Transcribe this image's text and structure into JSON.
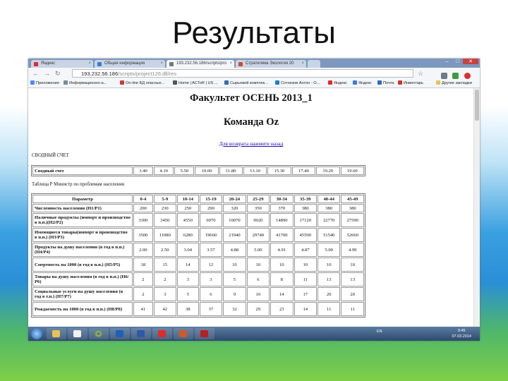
{
  "slide": {
    "title": "Результаты"
  },
  "browser": {
    "tabs": [
      {
        "label": "Яндекс",
        "color": "#e02b2b"
      },
      {
        "label": "Общая информация",
        "color": "#3b7bd4"
      },
      {
        "label": "193.232.56.186/scripts/pro",
        "color": "#777777"
      },
      {
        "label": "Стратегема Экология 20",
        "color": "#d04a2a"
      }
    ],
    "address_host": "193.232.56.186",
    "address_path": "/scripts/project126.dll/res",
    "bookmarks": [
      "Приложения",
      "Информационно-а...",
      "On-line БД опасных...",
      "Home | ACToR | US ...",
      "Сырьевой комплек...",
      "Сотнезов Антон - О...",
      "Яндекс",
      "Яндекс",
      "Почта",
      "Инвентарь",
      "Другие закладки"
    ]
  },
  "page": {
    "heading1": "Факультет ОСЕНЬ 2013_1",
    "heading2": "Команда Oz",
    "back_link": "Для возврата нажмите назад",
    "summary_label": "СВОДНЫЙ СЧЕТ",
    "summary": {
      "label": "Сводный счет",
      "values": [
        "3.40",
        "4.10",
        "5.50",
        "10.00",
        "11.80",
        "13.10",
        "15.30",
        "17.40",
        "19.20",
        "19.60"
      ]
    },
    "table2_label": "Таблица Р Министр по проблемам населения",
    "table2": {
      "header": [
        "Параметр",
        "0-4",
        "5-9",
        "10-14",
        "15-19",
        "20-24",
        "25-29",
        "30-34",
        "35-39",
        "40-44",
        "45-49"
      ],
      "rows": [
        {
          "p": "Численность населения (Н1/Р1)",
          "v": [
            "200",
            "230",
            "250",
            "290",
            "320",
            "350",
            "370",
            "380",
            "380",
            "380"
          ]
        },
        {
          "p": "Наличные продукты (импорт и производство в п.п.)(Н2/Р2)",
          "v": [
            "3300",
            "3450",
            "4550",
            "6970",
            "10070",
            "9020",
            "14890",
            "17120",
            "22770",
            "27590"
          ]
        },
        {
          "p": "Имеющиеся товары(импорт и производство в п.п.) (Н3/Р3)",
          "v": [
            "3500",
            "11080",
            "6280",
            "19660",
            "21940",
            "29740",
            "41700",
            "45590",
            "51540",
            "52660"
          ]
        },
        {
          "p": "Продукты на душу населения (в год в п.п.) (Н4/Р4)",
          "v": [
            "2.00",
            "2.50",
            "3.04",
            "3.57",
            "4.88",
            "5.00",
            "4.91",
            "4.87",
            "5.00",
            "4.99"
          ]
        },
        {
          "p": "Смертность на 1000 (в год в п.п.) (Н5/Р5)",
          "v": [
            "18",
            "15",
            "14",
            "12",
            "10",
            "10",
            "10",
            "10",
            "10",
            "10"
          ]
        },
        {
          "p": "Товары на душу населения (в год в п.п.) (Н6/Р6)",
          "v": [
            "2",
            "2",
            "3",
            "3",
            "5",
            "6",
            "8",
            "11",
            "13",
            "13"
          ]
        },
        {
          "p": "Социальные услуги на душу населения (в год в т.п.) (Н7/Р7)",
          "v": [
            "2",
            "3",
            "5",
            "6",
            "9",
            "10",
            "14",
            "17",
            "20",
            "20"
          ]
        },
        {
          "p": "Рождаемость на 1000 (в год в п.п.) (Н8/Р8)",
          "v": [
            "41",
            "42",
            "38",
            "37",
            "32",
            "29",
            "23",
            "14",
            "11",
            "11"
          ]
        }
      ]
    }
  },
  "taskbar": {
    "lang": "EN",
    "time": "9:45",
    "date": "07.03.2014"
  }
}
